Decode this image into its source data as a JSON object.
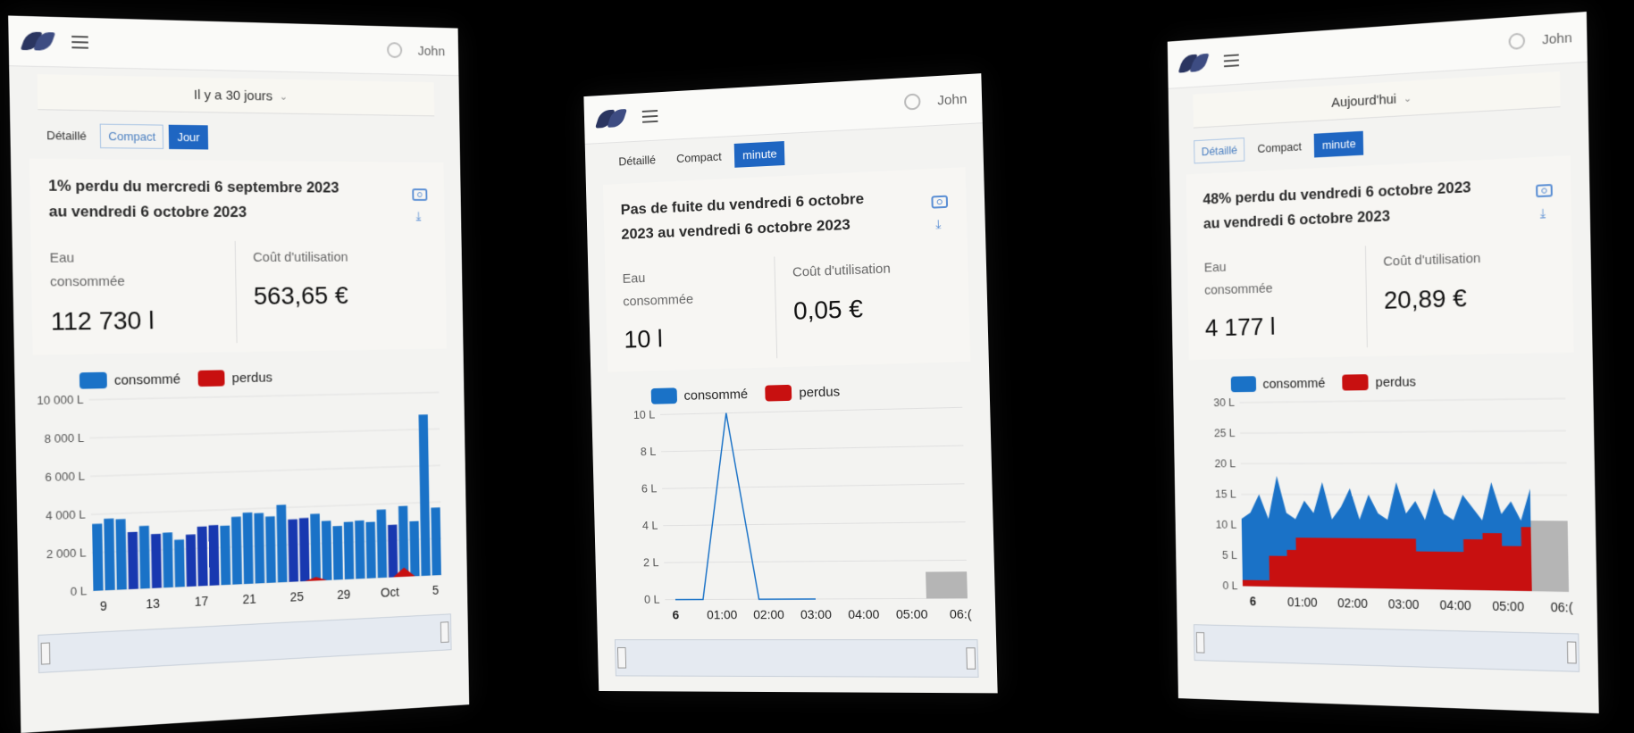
{
  "user_name": "John",
  "panels": [
    {
      "period": "Il y a 30 jours",
      "modes": [
        "Détaillé",
        "Compact",
        "Jour"
      ],
      "active_mode": 2,
      "outlined_mode": 1,
      "headline": "1% perdu du mercredi 6 septembre 2023 au vendredi 6 octobre 2023",
      "water_label": "Eau consommée",
      "water_value": "112 730 l",
      "cost_label": "Coût d'utilisation",
      "cost_value": "563,65 €",
      "legend": [
        "consommé",
        "perdus"
      ],
      "chart_data": {
        "type": "bar",
        "y_ticks": [
          "10 000 L",
          "8 000 L",
          "6 000 L",
          "4 000 L",
          "2 000 L",
          "0 L"
        ],
        "x_ticks": [
          "9",
          "13",
          "17",
          "21",
          "25",
          "29",
          "Oct",
          "5"
        ],
        "ylim": [
          0,
          10000
        ],
        "series": [
          {
            "name": "consommé",
            "values": [
              3500,
              3750,
              3700,
              3000,
              3300,
              2850,
              2900,
              2500,
              2750,
              3150,
              3200,
              3150,
              3600,
              3800,
              3750,
              3550,
              4150,
              3350,
              3400,
              3600,
              3200,
              2900,
              3100,
              3150,
              3050,
              3700,
              2850,
              3850,
              3000,
              8800,
              3700
            ]
          },
          {
            "name": "perdus",
            "values": [
              0,
              0,
              0,
              0,
              0,
              0,
              0,
              0,
              0,
              0,
              0,
              0,
              0,
              0,
              0,
              0,
              0,
              0,
              0,
              200,
              0,
              0,
              0,
              0,
              0,
              0,
              0,
              500,
              0,
              0,
              0
            ]
          }
        ]
      }
    },
    {
      "modes": [
        "Détaillé",
        "Compact",
        "minute"
      ],
      "active_mode": 2,
      "outlined_mode": -1,
      "headline": "Pas de fuite du vendredi 6 octobre 2023 au vendredi 6 octobre 2023",
      "water_label": "Eau consommée",
      "water_value": "10 l",
      "cost_label": "Coût d'utilisation",
      "cost_value": "0,05 €",
      "legend": [
        "consommé",
        "perdus"
      ],
      "chart_data": {
        "type": "line",
        "y_ticks": [
          "10 L",
          "8 L",
          "6 L",
          "4 L",
          "2 L",
          "0 L"
        ],
        "x_ticks": [
          "6",
          "01:00",
          "02:00",
          "03:00",
          "04:00",
          "05:00",
          "06:("
        ],
        "ylim": [
          0,
          10
        ],
        "series": [
          {
            "name": "consommé",
            "values": [
              0,
              0,
              10,
              0,
              0,
              0
            ]
          }
        ]
      }
    },
    {
      "period": "Aujourd'hui",
      "modes": [
        "Détaillé",
        "Compact",
        "minute"
      ],
      "active_mode": 2,
      "outlined_mode": 0,
      "headline": "48% perdu du vendredi 6 octobre 2023 au vendredi 6 octobre 2023",
      "water_label": "Eau consommée",
      "water_value": "4 177 l",
      "cost_label": "Coût d'utilisation",
      "cost_value": "20,89 €",
      "legend": [
        "consommé",
        "perdus"
      ],
      "chart_data": {
        "type": "area",
        "y_ticks": [
          "30 L",
          "25 L",
          "20 L",
          "15 L",
          "10 L",
          "5 L",
          "0 L"
        ],
        "x_ticks": [
          "6",
          "01:00",
          "02:00",
          "03:00",
          "04:00",
          "05:00",
          "06:("
        ],
        "ylim": [
          0,
          30
        ],
        "series": [
          {
            "name": "consommé",
            "values": [
              11,
              12,
              15,
              11,
              18,
              12,
              11,
              14,
              12,
              17,
              11,
              13,
              16,
              11,
              15,
              12,
              11,
              17,
              12,
              14,
              11,
              16,
              12,
              11,
              15,
              13,
              11,
              17,
              12,
              14,
              11,
              16
            ]
          },
          {
            "name": "perdus",
            "values": [
              1,
              1,
              1,
              5,
              5,
              6,
              8,
              8,
              8,
              8,
              8,
              8,
              8,
              8,
              8,
              8,
              8,
              8,
              8,
              6,
              6,
              6,
              6,
              6,
              8,
              8,
              9,
              9,
              7,
              7,
              10,
              10
            ]
          }
        ]
      }
    }
  ],
  "colors": {
    "consumed": "#1a72c7",
    "lost": "#c81010",
    "accent": "#1f66c2"
  }
}
